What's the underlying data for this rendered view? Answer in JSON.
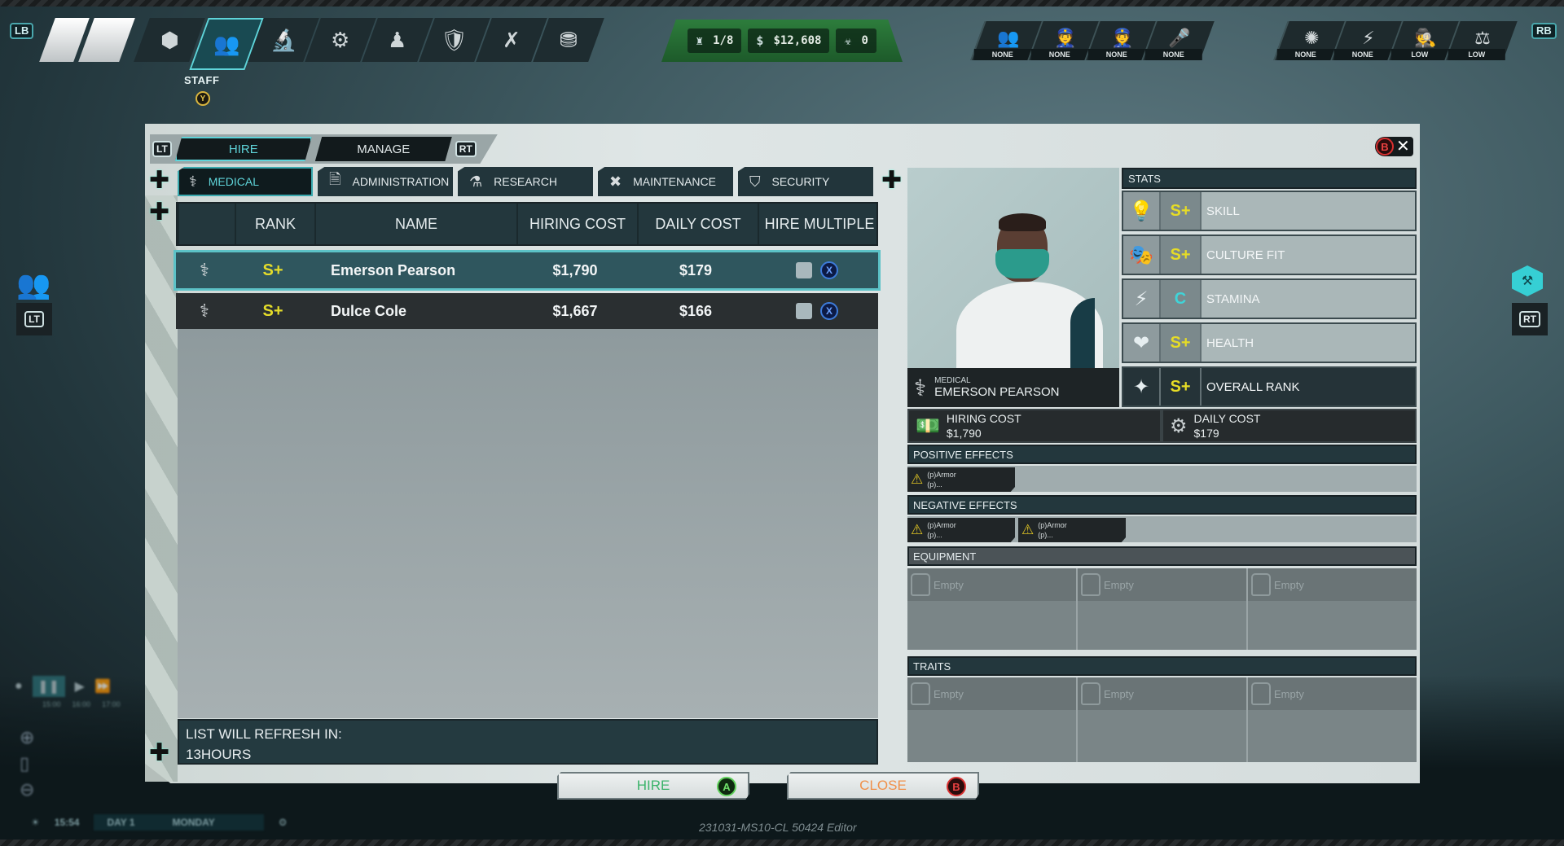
{
  "hud": {
    "lb_label": "LB",
    "rb_label": "RB",
    "nav_items": [
      {
        "icon": "build-cube-icon",
        "glyph": "⬢",
        "label": ""
      },
      {
        "icon": "staff-icon",
        "glyph": "👥",
        "label": "STAFF",
        "active": true
      },
      {
        "icon": "microscope-icon",
        "glyph": "🔬",
        "label": ""
      },
      {
        "icon": "robot-arm-icon",
        "glyph": "⚙",
        "label": ""
      },
      {
        "icon": "minion-icon",
        "glyph": "♟",
        "label": ""
      },
      {
        "icon": "security-scroll-icon",
        "glyph": "🛡",
        "label": ""
      },
      {
        "icon": "scheme-map-icon",
        "glyph": "✗",
        "label": ""
      },
      {
        "icon": "treasure-chest-icon",
        "glyph": "⛃",
        "label": ""
      }
    ],
    "staff_label": "STAFF",
    "y_button": "Y",
    "resources": [
      {
        "name": "minions",
        "icon": "minion-count-icon",
        "glyph": "♜",
        "value": "1/8"
      },
      {
        "name": "money",
        "icon": "cash-icon",
        "glyph": "$",
        "value": "$12,608"
      },
      {
        "name": "infamy",
        "icon": "biohazard-icon",
        "glyph": "☣",
        "value": "0"
      }
    ],
    "heat_meters_left": [
      {
        "icon": "agents-icon",
        "glyph": "👥",
        "level": "NONE"
      },
      {
        "icon": "soldiers-icon",
        "glyph": "👮",
        "level": "NONE"
      },
      {
        "icon": "police-icon",
        "glyph": "👮",
        "level": "NONE"
      },
      {
        "icon": "reporter-icon",
        "glyph": "🎤",
        "level": "NONE"
      }
    ],
    "heat_meters_right": [
      {
        "icon": "virus-icon",
        "glyph": "✺",
        "level": "NONE"
      },
      {
        "icon": "chaos-icon",
        "glyph": "⚡",
        "level": "NONE"
      },
      {
        "icon": "investigator-icon",
        "glyph": "🕵",
        "level": "LOW"
      },
      {
        "icon": "justice-scales-icon",
        "glyph": "⚖",
        "level": "LOW"
      }
    ],
    "left_side_trigger": "LT",
    "right_side_trigger": "RT"
  },
  "dialog": {
    "mode_tabs": [
      {
        "label": "HIRE",
        "active": true
      },
      {
        "label": "MANAGE",
        "active": false
      }
    ],
    "lt_label": "LT",
    "rt_label": "RT",
    "close_badge": "B",
    "close_glyph": "✕",
    "dept_tabs": [
      {
        "label": "MEDICAL",
        "icon": "caduceus-icon",
        "glyph": "⚕",
        "active": true
      },
      {
        "label": "ADMINISTRATION",
        "icon": "document-icon",
        "glyph": "🗎",
        "active": false
      },
      {
        "label": "RESEARCH",
        "icon": "flask-icon",
        "glyph": "⚗",
        "active": false
      },
      {
        "label": "MAINTENANCE",
        "icon": "wrench-icon",
        "glyph": "✖",
        "active": false
      },
      {
        "label": "SECURITY",
        "icon": "shield-icon",
        "glyph": "⛉",
        "active": false
      }
    ],
    "table": {
      "columns": [
        "",
        "RANK",
        "NAME",
        "HIRING COST",
        "DAILY COST",
        "HIRE MULTIPLE"
      ],
      "rows": [
        {
          "dept_glyph": "⚕",
          "rank": "S+",
          "name": "Emerson Pearson",
          "hiring_cost": "$1,790",
          "daily_cost": "$179",
          "selected": true,
          "x_button": "X"
        },
        {
          "dept_glyph": "⚕",
          "rank": "S+",
          "name": "Dulce Cole",
          "hiring_cost": "$1,667",
          "daily_cost": "$166",
          "selected": false,
          "x_button": "X"
        }
      ]
    },
    "refresh_label": "LIST WILL REFRESH IN:",
    "refresh_value": "13HOURS",
    "detail": {
      "department": "MEDICAL",
      "name": "EMERSON PEARSON",
      "stats_header": "STATS",
      "stats": [
        {
          "icon": "lightbulb-icon",
          "glyph": "💡",
          "grade": "S+",
          "label": "SKILL",
          "grade_color": "#e6dc26"
        },
        {
          "icon": "theater-masks-icon",
          "glyph": "🎭",
          "grade": "S+",
          "label": "CULTURE FIT",
          "grade_color": "#e6dc26"
        },
        {
          "icon": "lightning-icon",
          "glyph": "⚡",
          "grade": "C",
          "label": "STAMINA",
          "grade_color": "#3fd4d8"
        },
        {
          "icon": "heart-icon",
          "glyph": "❤",
          "grade": "S+",
          "label": "HEALTH",
          "grade_color": "#e6dc26"
        },
        {
          "icon": "star-rank-icon",
          "glyph": "✦",
          "grade": "S+",
          "label": "OVERALL RANK",
          "grade_color": "#e6dc26"
        }
      ],
      "hiring_cost_label": "HIRING COST",
      "hiring_cost_value": "$1,790",
      "daily_cost_label": "DAILY COST",
      "daily_cost_value": "$179",
      "positive_effects_label": "POSITIVE EFFECTS",
      "positive_effects": [
        {
          "line1": "(p)Armor",
          "line2": "(p)..."
        }
      ],
      "negative_effects_label": "NEGATIVE EFFECTS",
      "negative_effects": [
        {
          "line1": "(p)Armor",
          "line2": "(p)..."
        },
        {
          "line1": "(p)Armor",
          "line2": "(p)..."
        }
      ],
      "equipment_label": "EQUIPMENT",
      "equipment": [
        "Empty",
        "Empty",
        "Empty"
      ],
      "traits_label": "TRAITS",
      "traits": [
        "Empty",
        "Empty",
        "Empty"
      ]
    },
    "hire_button": {
      "label": "HIRE",
      "badge": "A"
    },
    "close_button": {
      "label": "CLOSE",
      "badge": "B"
    }
  },
  "time": {
    "clock": "15:54",
    "day": "DAY 1",
    "weekday": "MONDAY",
    "ticks": [
      "15:00",
      "16:00",
      "17:00"
    ]
  },
  "version": "231031-MS10-CL 50424 Editor",
  "colors": {
    "accent_cyan": "#5fd4d9",
    "grade_yellow": "#e6dc26",
    "resource_green": "#2d7d3c",
    "hire_green": "#3bb36a",
    "close_orange": "#f0904a"
  }
}
